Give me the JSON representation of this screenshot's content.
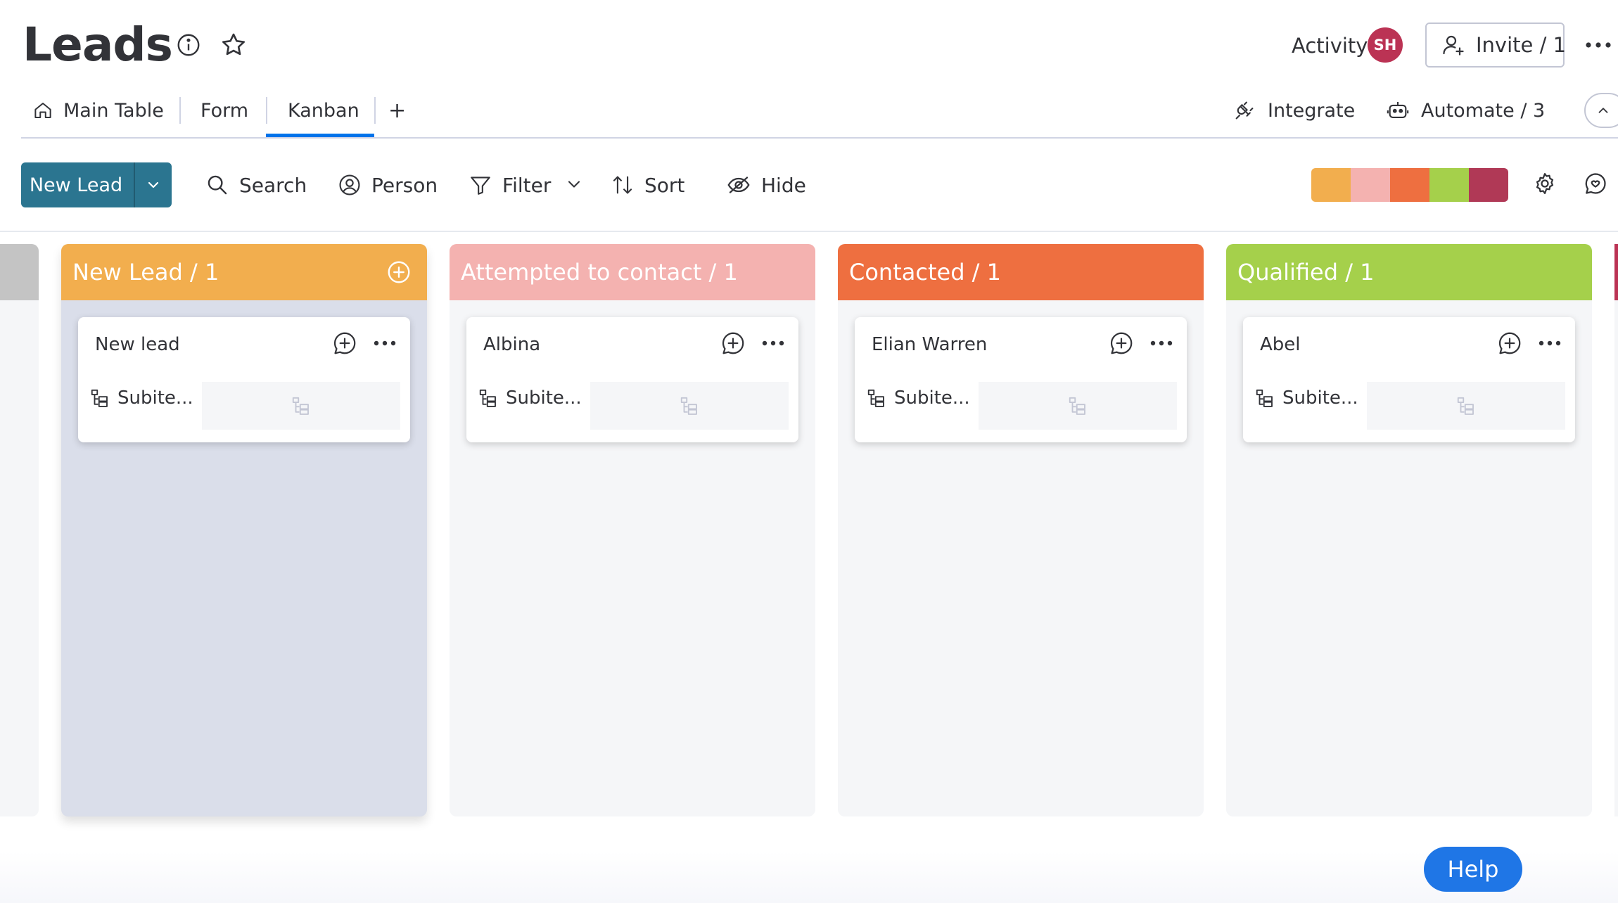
{
  "header": {
    "title": "Leads",
    "activity_label": "Activity",
    "avatar_initials": "SH",
    "invite_label": "Invite / 1"
  },
  "tabs": [
    {
      "label": "Main Table",
      "icon": "home-icon"
    },
    {
      "label": "Form"
    },
    {
      "label": "Kanban",
      "active": true
    },
    {
      "label": "+"
    }
  ],
  "right_actions": {
    "integrate_label": "Integrate",
    "automate_label": "Automate / 3"
  },
  "toolbar": {
    "new_item_label": "New Lead",
    "search_label": "Search",
    "person_label": "Person",
    "filter_label": "Filter",
    "sort_label": "Sort",
    "hide_label": "Hide",
    "status_colors": [
      "#f2ae4e",
      "#f4b2b0",
      "#ee6f40",
      "#a5d04b",
      "#b03956"
    ]
  },
  "columns": [
    {
      "title": "New Lead / 1",
      "color": "#f2ae4e",
      "highlighted": true,
      "cards": [
        {
          "name": "New lead",
          "subitems_label": "Subite..."
        }
      ]
    },
    {
      "title": "Attempted to contact / 1",
      "color": "#f4b2b0",
      "cards": [
        {
          "name": "Albina",
          "subitems_label": "Subite..."
        }
      ]
    },
    {
      "title": "Contacted / 1",
      "color": "#ee6f40",
      "cards": [
        {
          "name": "Elian Warren",
          "subitems_label": "Subite..."
        }
      ]
    },
    {
      "title": "Qualified / 1",
      "color": "#a5d04b",
      "cards": [
        {
          "name": "Abel",
          "subitems_label": "Subite..."
        }
      ]
    }
  ],
  "help_label": "Help"
}
